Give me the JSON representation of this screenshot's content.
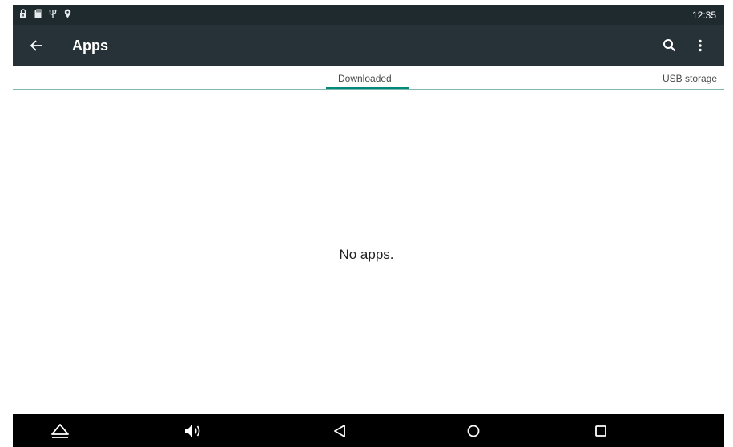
{
  "status_bar": {
    "time": "12:35",
    "icons": [
      "lock-icon",
      "sd-card-icon",
      "usb-icon",
      "location-pin-icon"
    ]
  },
  "app_bar": {
    "title": "Apps",
    "back_icon": "arrow-left-icon",
    "search_icon": "search-icon",
    "overflow_icon": "more-vert-icon"
  },
  "tabs": [
    {
      "label": "Downloaded",
      "selected": true
    },
    {
      "label": "USB storage",
      "selected": false
    }
  ],
  "content": {
    "empty_message": "No apps."
  },
  "nav_bar": {
    "icons": [
      "eject-icon",
      "volume-icon",
      "back-triangle-icon",
      "home-circle-icon",
      "recents-square-icon"
    ]
  },
  "colors": {
    "status_bar": "#1f2a2f",
    "app_bar": "#263238",
    "tab_indicator": "#00897b",
    "nav_bar": "#000000"
  }
}
